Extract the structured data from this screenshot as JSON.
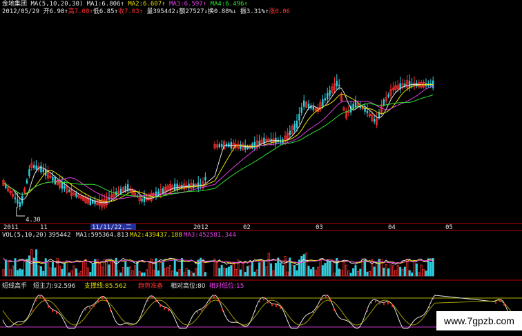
{
  "header": {
    "stock_name": "金地集团",
    "ma_label": "MA(5,10,20,30)",
    "ma1": "MA1:6.806",
    "ma2": "MA2:6.607",
    "ma3": "MA3:6.597",
    "ma4": "MA4:6.496",
    "date": "2012/05/29",
    "open": "开6.90",
    "high": "高7.08",
    "low": "低6.85",
    "close": "收7.03",
    "volume": "量395442",
    "amount": "额27527",
    "turnover": "换0.88%",
    "amplitude": "振3.31%",
    "change": "涨0.06"
  },
  "price_chart": {
    "low_marker": "4.30",
    "x_axis_labels": [
      "2011",
      "11",
      "11/11/22,二",
      "2012",
      "02",
      "03",
      "04",
      "05"
    ]
  },
  "volume_panel": {
    "label": "VOL(5,10,20)",
    "value": "395442",
    "ma1": "MA1:595364.813",
    "ma2": "MA2:439437.188",
    "ma3": "MA3:452581.344"
  },
  "indicator_panel": {
    "name": "短线高手",
    "main_force": "短主力:92.596",
    "support": "支撑线:85.562",
    "trend": "趋势准备",
    "rel_high": "相对高位:80",
    "rel_low": "相对低位:15"
  },
  "watermark": "www.7gpzb.com",
  "colors": {
    "background": "#000000",
    "up_candle": "#ff3030",
    "down_candle": "#30d0e0",
    "ma1": "#e6e6e6",
    "ma2": "#e8e000",
    "ma3": "#e040e0",
    "ma4": "#30e030"
  }
}
